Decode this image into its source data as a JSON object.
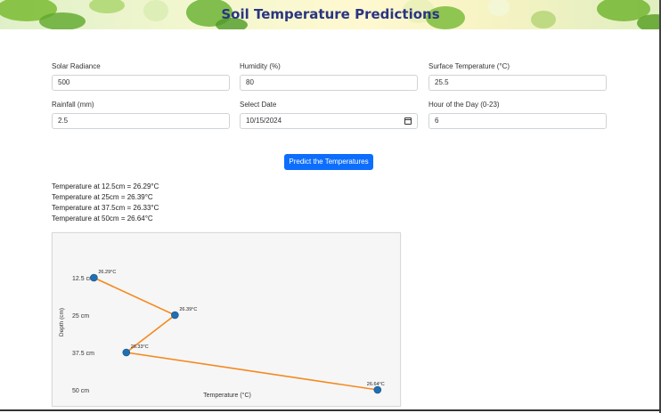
{
  "header": {
    "title": "Soil Temperature Predictions"
  },
  "form": {
    "solar_radiance": {
      "label": "Solar Radiance",
      "value": "500"
    },
    "humidity": {
      "label": "Humidity (%)",
      "value": "80"
    },
    "surface_temperature": {
      "label": "Surface Temperature (°C)",
      "value": "25.5"
    },
    "rainfall": {
      "label": "Rainfall (mm)",
      "value": "2.5"
    },
    "date": {
      "label": "Select Date",
      "value": "10/15/2024"
    },
    "hour": {
      "label": "Hour of the Day (0-23)",
      "value": "6"
    },
    "submit_label": "Predict the Temperatures"
  },
  "results": [
    "Temperature at 12.5cm = 26.29°C",
    "Temperature at 25cm = 26.39°C",
    "Temperature at 37.5cm = 26.33°C",
    "Temperature at 50cm = 26.64°C"
  ],
  "colors": {
    "accent": "#0d6efd",
    "title": "#2a3580",
    "line": "#f5891f",
    "marker": "#1f6fb2"
  },
  "chart_data": {
    "type": "line",
    "xlabel": "Temperature (°C)",
    "ylabel": "Depth (cm)",
    "categories": [
      "12.5 cm",
      "25 cm",
      "37.5 cm",
      "50 cm"
    ],
    "series": [
      {
        "x": [
          26.29,
          26.39,
          26.33,
          26.64
        ],
        "labels": [
          "26.29°C",
          "26.39°C",
          "26.33°C",
          "26.64°C"
        ]
      }
    ],
    "xlim": [
      26.25,
      26.66
    ],
    "grid": false
  }
}
